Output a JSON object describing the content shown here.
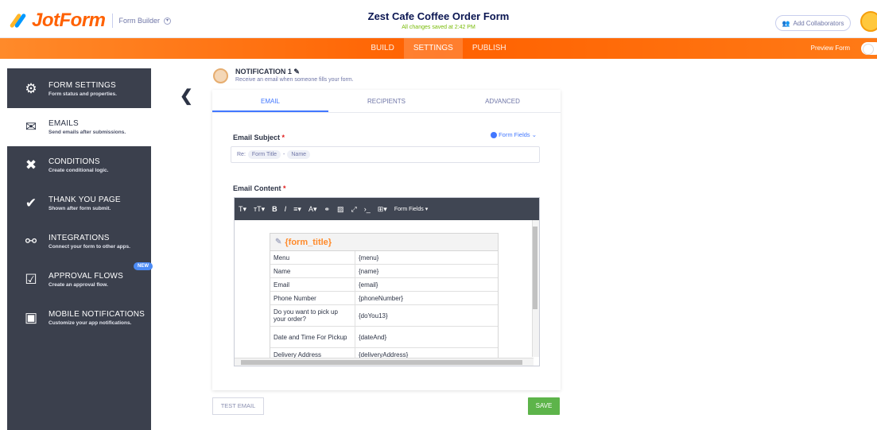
{
  "header": {
    "logo_text": "JotForm",
    "builder_label": "Form Builder",
    "form_title": "Zest Cafe Coffee Order Form",
    "saved_status": "All changes saved at 2:42 PM",
    "collaborators_label": "Add Collaborators"
  },
  "nav": {
    "tabs": [
      "BUILD",
      "SETTINGS",
      "PUBLISH"
    ],
    "active_tab": "SETTINGS",
    "preview_label": "Preview Form"
  },
  "sidebar": {
    "items": [
      {
        "label": "FORM SETTINGS",
        "desc": "Form status and properties.",
        "icon": "gear-icon"
      },
      {
        "label": "EMAILS",
        "desc": "Send emails after submissions.",
        "icon": "envelope-icon"
      },
      {
        "label": "CONDITIONS",
        "desc": "Create conditional logic.",
        "icon": "tools-icon"
      },
      {
        "label": "THANK YOU PAGE",
        "desc": "Shown after form submit.",
        "icon": "check-circle-icon"
      },
      {
        "label": "INTEGRATIONS",
        "desc": "Connect your form to other apps.",
        "icon": "link-icon"
      },
      {
        "label": "APPROVAL FLOWS",
        "desc": "Create an approval flow.",
        "icon": "approval-icon",
        "badge": "NEW"
      },
      {
        "label": "MOBILE NOTIFICATIONS",
        "desc": "Customize your app notifications.",
        "icon": "mobile-icon"
      }
    ],
    "active_index": 1
  },
  "notification": {
    "title": "NOTIFICATION 1",
    "subtitle": "Receive an email when someone fills your form."
  },
  "tabs": [
    "EMAIL",
    "RECIPIENTS",
    "ADVANCED"
  ],
  "active_tab": "EMAIL",
  "email": {
    "subject_label": "Email Subject",
    "form_fields_label": "Form Fields",
    "subject_prefix": "Re:",
    "subject_chips": [
      "Form Title",
      "-",
      "Name"
    ],
    "content_label": "Email Content",
    "toolbar_form_fields": "Form Fields",
    "table_title": "{form_title}",
    "rows": [
      {
        "label": "Menu",
        "value": "{menu}"
      },
      {
        "label": "Name",
        "value": "{name}"
      },
      {
        "label": "Email",
        "value": "{email}"
      },
      {
        "label": "Phone Number",
        "value": "{phoneNumber}"
      },
      {
        "label": "Do you want to pick up your order?",
        "value": "{doYou13}"
      },
      {
        "label": "Date and Time For Pickup",
        "value": "{dateAnd}"
      },
      {
        "label": "Delivery Address",
        "value": "{deliveryAddress}"
      }
    ]
  },
  "buttons": {
    "test_email": "TEST EMAIL",
    "save": "SAVE"
  },
  "colors": {
    "brand_orange": "#ff6100",
    "sidebar_bg": "#3b404d",
    "accent_blue": "#4277ff",
    "save_green": "#5db44a"
  }
}
